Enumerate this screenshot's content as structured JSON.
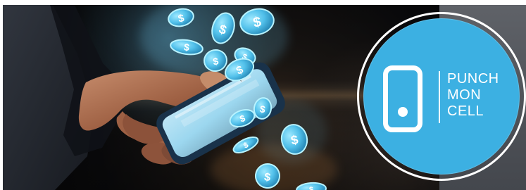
{
  "brand": {
    "lines": [
      "PUNCH",
      "MON",
      "CELL"
    ],
    "accent": "#3cb0e2",
    "white": "#ffffff"
  },
  "imagery": {
    "currency_icon": "dollar-coin-icon",
    "device_icon": "smartphone-icon",
    "glow_color": "#72d2ff"
  }
}
